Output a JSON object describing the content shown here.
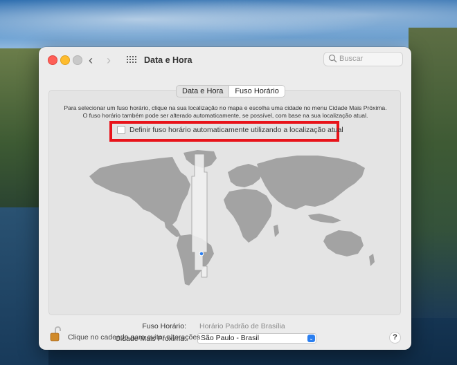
{
  "window": {
    "title": "Data e Hora",
    "search_placeholder": "Buscar"
  },
  "tabs": [
    {
      "label": "Data e Hora",
      "active": false
    },
    {
      "label": "Fuso Horário",
      "active": true
    }
  ],
  "panel": {
    "description_line1": "Para selecionar um fuso horário, clique na sua localização no mapa e escolha uma cidade no menu Cidade Mais Próxima.",
    "description_line2": "O fuso horário também pode ser alterado automaticamente, se possível, com base na sua localização atual.",
    "auto_timezone_label": "Definir fuso horário automaticamente utilizando a localização atual",
    "auto_timezone_checked": false,
    "timezone_label": "Fuso Horário:",
    "timezone_value": "Horário Padrão de Brasília",
    "city_label": "Cidade Mais Próxima:",
    "city_value": "São Paulo - Brasil"
  },
  "footer": {
    "lock_text": "Clique no cadeado para evitar alterações.",
    "help_label": "?"
  },
  "icons": {
    "back": "chevron-left-icon",
    "forward": "chevron-right-icon",
    "show_all": "grid-icon",
    "search": "search-icon",
    "lock": "lock-open-icon",
    "select_arrow": "chevron-updown-icon"
  },
  "colors": {
    "highlight": "#e8131a",
    "accent": "#2b7ff0",
    "close": "#fe5f57",
    "minimize": "#febc2e",
    "map_land": "#a3a3a3",
    "selected_zone": "#f0f0f0"
  }
}
